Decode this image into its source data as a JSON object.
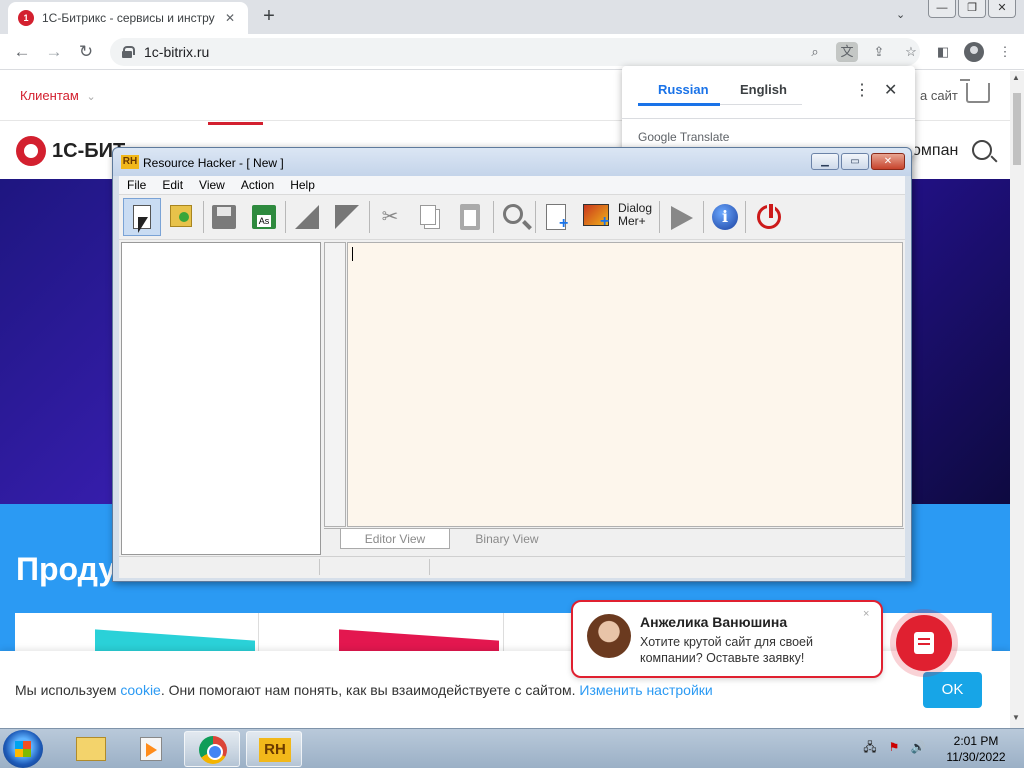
{
  "browser": {
    "tab_title": "1С-Битрикс - сервисы и инстру",
    "new_tab": "+",
    "tab_search": "⌄",
    "url": "1c-bitrix.ru"
  },
  "site": {
    "clients": "Клиентам",
    "clients_chevron": "⌄",
    "site_right": "а сайт",
    "logo": "1С-БИТ",
    "company": "омпан",
    "products_heading": "Проду",
    "cookie": {
      "prefix": "Мы используем ",
      "cookie_link": "cookie",
      "middle": ". Они помогают нам понять, как вы взаимодействуете с сайтом. ",
      "settings_link": "Изменить настройки",
      "ok": "OK"
    },
    "chat": {
      "name": "Анжелика Ванюшина",
      "message": "Хотите крутой сайт для своей компании? Оставьте заявку!",
      "close": "×"
    }
  },
  "translate": {
    "lang_source": "Russian",
    "lang_target": "English",
    "more": "⋮",
    "close": "✕",
    "brand": "Google Translate"
  },
  "rh": {
    "app_icon": "RH",
    "title": "Resource Hacker - [ New ]",
    "menu": [
      "File",
      "Edit",
      "View",
      "Action",
      "Help"
    ],
    "dialog_button": "Dialog\nMer+",
    "tab_editor": "Editor View",
    "tab_binary": "Binary View"
  },
  "taskbar": {
    "rh_label": "RH",
    "time": "2:01 PM",
    "date": "11/30/2022"
  },
  "icons": [
    "new-file-icon",
    "open-file-icon",
    "save-icon",
    "save-as-icon",
    "compile-icon",
    "decompile-icon",
    "cut-icon",
    "copy-icon",
    "paste-icon",
    "find-icon",
    "add-resource-icon",
    "add-image-icon",
    "dialog-merge-icon",
    "play-icon",
    "info-icon",
    "power-icon"
  ]
}
